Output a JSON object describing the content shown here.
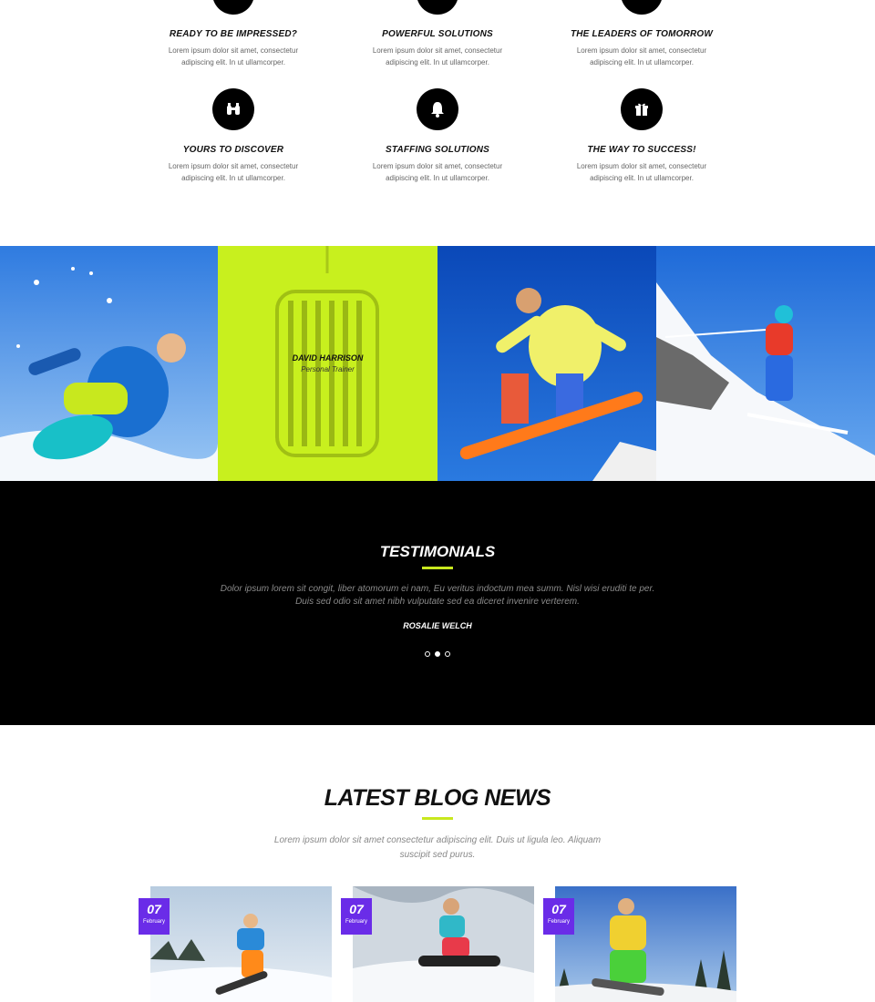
{
  "features": [
    {
      "title": "READY TO BE IMPRESSED?",
      "text": "Lorem ipsum dolor sit amet, consectetur adipiscing elit. In ut ullamcorper.",
      "icon": "star-icon"
    },
    {
      "title": "POWERFUL SOLUTIONS",
      "text": "Lorem ipsum dolor sit amet, consectetur adipiscing elit. In ut ullamcorper.",
      "icon": "bolt-icon"
    },
    {
      "title": "THE LEADERS OF TOMORROW",
      "text": "Lorem ipsum dolor sit amet, consectetur adipiscing elit. In ut ullamcorper.",
      "icon": "trophy-icon"
    },
    {
      "title": "YOURS TO DISCOVER",
      "text": "Lorem ipsum dolor sit amet, consectetur adipiscing elit. In ut ullamcorper.",
      "icon": "binoculars-icon"
    },
    {
      "title": "STAFFING SOLUTIONS",
      "text": "Lorem ipsum dolor sit amet, consectetur adipiscing elit. In ut ullamcorper.",
      "icon": "bell-icon"
    },
    {
      "title": "THE WAY TO SUCCESS!",
      "text": "Lorem ipsum dolor sit amet, consectetur adipiscing elit. In ut ullamcorper.",
      "icon": "gift-icon"
    }
  ],
  "gallery": {
    "overlay_name": "DAVID HARRISON",
    "overlay_role": "Personal Trainer",
    "overlay_color": "#c8f01e"
  },
  "testimonials": {
    "title": "TESTIMONIALS",
    "quote": "Dolor ipsum lorem sit congit, liber atomorum ei nam, Eu veritus indoctum mea summ. Nisl wisi eruditi te per. Duis sed odio sit amet nibh vulputate sed ea diceret invenire verterem.",
    "author": "ROSALIE WELCH",
    "active_dot": 2
  },
  "blog": {
    "title": "LATEST BLOG NEWS",
    "subtitle": "Lorem ipsum dolor sit amet consectetur adipiscing elit. Duis ut ligula leo. Aliquam suscipit sed purus.",
    "posts": [
      {
        "day": "07",
        "month": "February"
      },
      {
        "day": "07",
        "month": "February"
      },
      {
        "day": "07",
        "month": "February"
      }
    ]
  },
  "colors": {
    "accent": "#c8e81e",
    "date_badge": "#6a2ce8"
  }
}
